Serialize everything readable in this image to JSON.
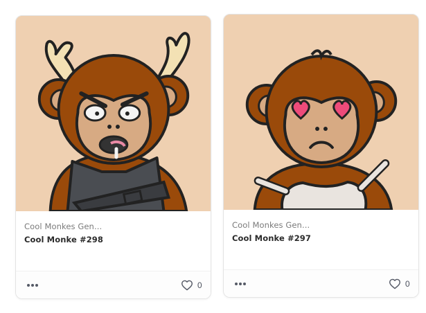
{
  "cards": [
    {
      "collection": "Cool Monkes Gen...",
      "name": "Cool Monke #298",
      "likes": "0",
      "art_alt": "Monkey with antlers and gun vest",
      "colors": {
        "background": "#efd0b1",
        "fur": "#9a4a0a",
        "face": "#d7aa83"
      }
    },
    {
      "collection": "Cool Monkes Gen...",
      "name": "Cool Monke #297",
      "likes": "0",
      "art_alt": "Monkey with heart eyes and white top",
      "colors": {
        "background": "#efd0b1",
        "fur": "#9a4a0a",
        "face": "#d7aa83"
      }
    }
  ],
  "icons": {
    "more": "more-horizontal-icon",
    "like": "heart-outline-icon"
  }
}
